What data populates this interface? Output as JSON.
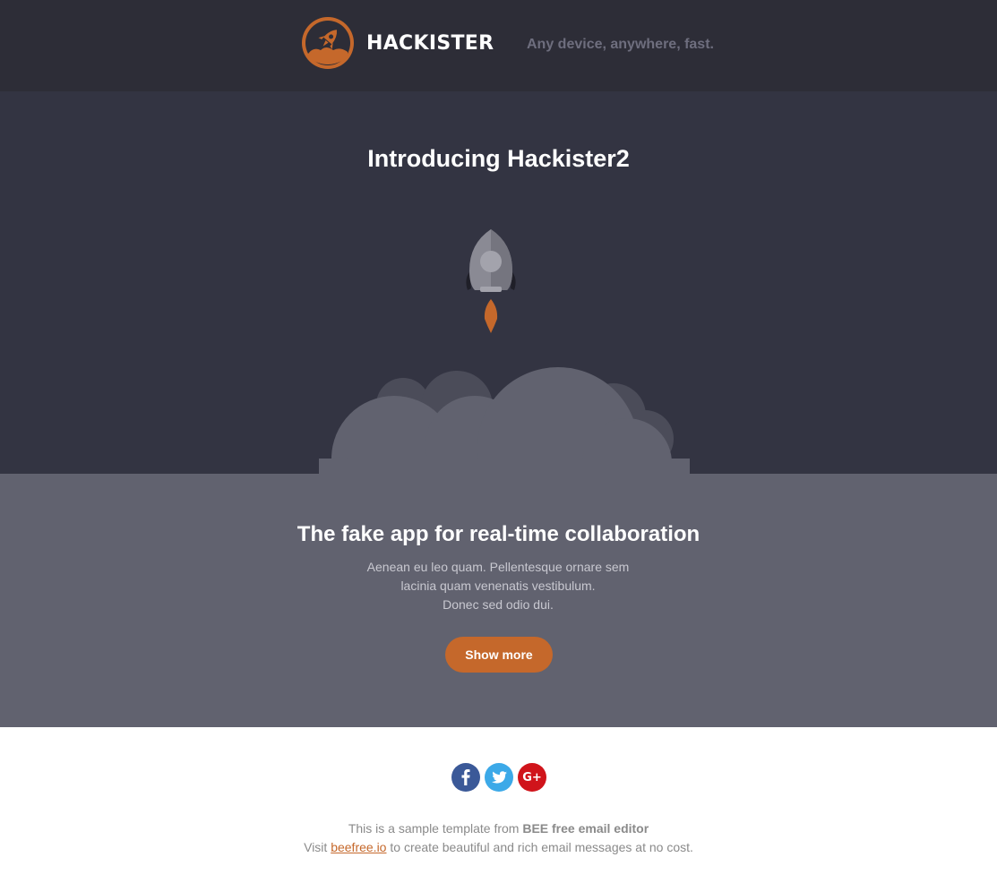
{
  "header": {
    "brand": "HACKISTER",
    "tagline": "Any device, anywhere, fast.",
    "logo_icon": "rocket-logo-icon"
  },
  "hero": {
    "title": "Introducing Hackister2",
    "illustration": "rocket-launch-illustration"
  },
  "feature": {
    "title": "The fake app for real-time collaboration",
    "body_lines": [
      "Aenean eu leo quam. Pellentesque ornare sem",
      "lacinia quam venenatis vestibulum.",
      "Donec sed odio dui."
    ],
    "button_label": "Show more"
  },
  "social": [
    {
      "name": "facebook",
      "glyph": "f"
    },
    {
      "name": "twitter",
      "glyph": ""
    },
    {
      "name": "google-plus",
      "glyph": "G+"
    }
  ],
  "footer": {
    "line1_prefix": "This is a sample template from ",
    "line1_bold": "BEE free email editor",
    "line2_prefix": "Visit ",
    "line2_link": "beefree.io",
    "line2_suffix": " to create beautiful and rich email messages at no cost."
  },
  "colors": {
    "header_bg": "#2d2d37",
    "hero_bg": "#333442",
    "band_bg": "#61626f",
    "accent": "#c5682b",
    "facebook": "#3b5998",
    "twitter": "#3ca9e8",
    "google_plus": "#d0141b"
  }
}
